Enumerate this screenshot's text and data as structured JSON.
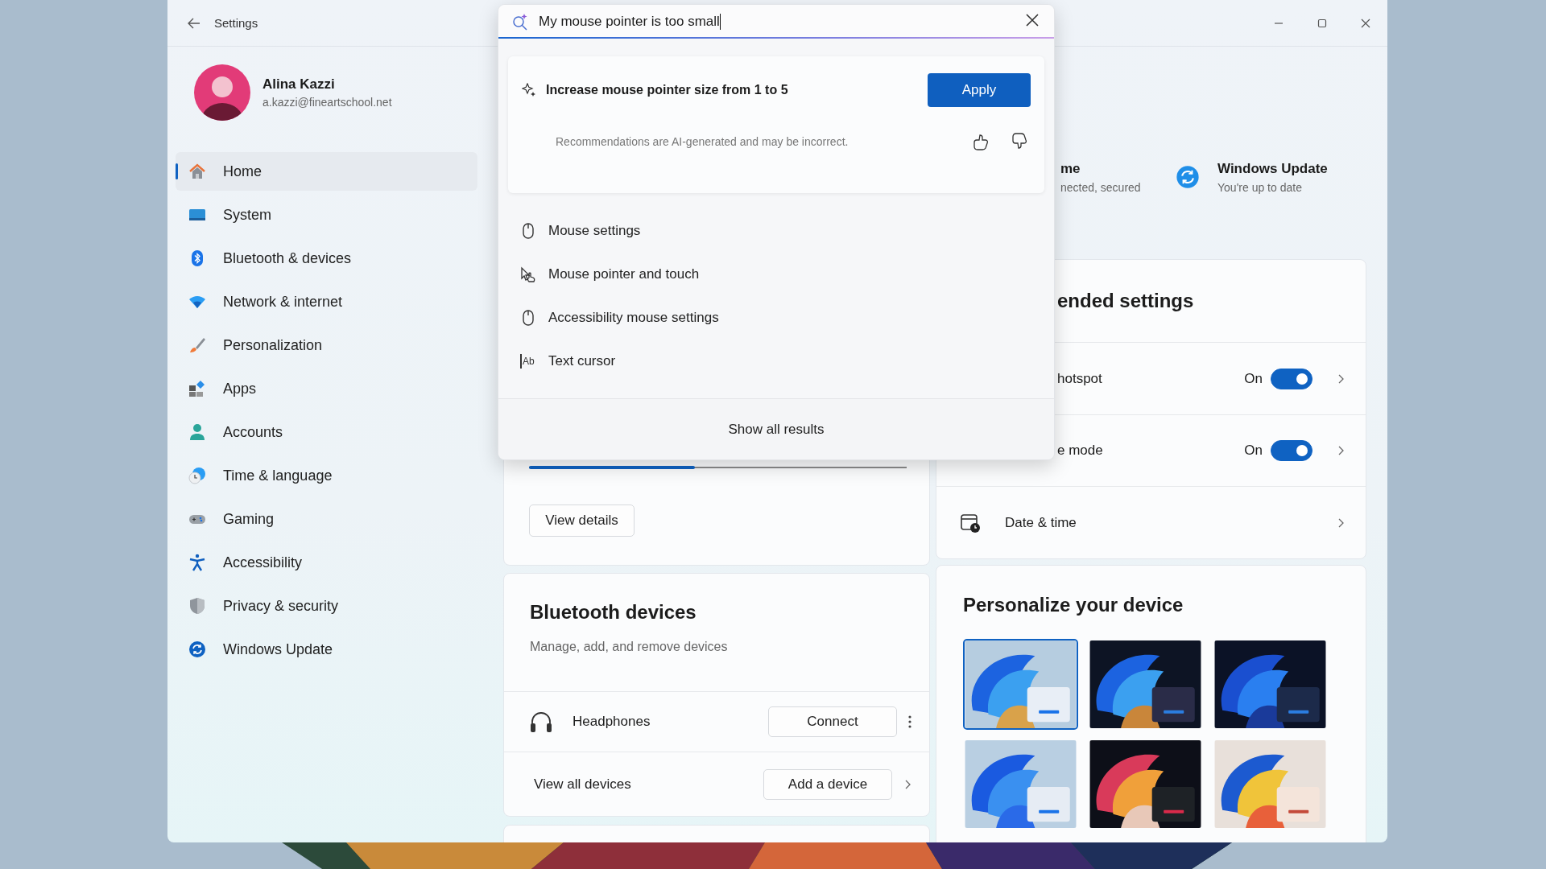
{
  "window": {
    "title": "Settings"
  },
  "profile": {
    "name": "Alina Kazzi",
    "email": "a.kazzi@fineartschool.net"
  },
  "sidebar": {
    "items": [
      {
        "label": "Home",
        "selected": true
      },
      {
        "label": "System",
        "selected": false
      },
      {
        "label": "Bluetooth & devices",
        "selected": false
      },
      {
        "label": "Network & internet",
        "selected": false
      },
      {
        "label": "Personalization",
        "selected": false
      },
      {
        "label": "Apps",
        "selected": false
      },
      {
        "label": "Accounts",
        "selected": false
      },
      {
        "label": "Time & language",
        "selected": false
      },
      {
        "label": "Gaming",
        "selected": false
      },
      {
        "label": "Accessibility",
        "selected": false
      },
      {
        "label": "Privacy & security",
        "selected": false
      },
      {
        "label": "Windows Update",
        "selected": false
      }
    ]
  },
  "status_tiles": [
    {
      "kind": "partial",
      "title": "me",
      "subtitle": "nected, secured"
    },
    {
      "kind": "update",
      "title": "Windows Update",
      "subtitle": "You're up to date"
    }
  ],
  "usage_card": {
    "level": 0.44,
    "button": "View details"
  },
  "bluetooth": {
    "title": "Bluetooth devices",
    "subtitle": "Manage, add, and remove devices",
    "device": {
      "name": "Headphones",
      "button": "Connect"
    },
    "footer": {
      "label": "View all devices",
      "button": "Add a device"
    }
  },
  "recommended": {
    "title": "ended settings",
    "rows": [
      {
        "kind": "toggle",
        "label": "hotspot",
        "state": "On",
        "on": true
      },
      {
        "kind": "toggle",
        "label": "e mode",
        "state": "On",
        "on": true
      },
      {
        "kind": "link",
        "label": "Date & time"
      }
    ]
  },
  "personalize": {
    "title": "Personalize your device",
    "themes": [
      {
        "kind": "light-bloom",
        "selected": true
      },
      {
        "kind": "dark-bloom",
        "selected": false
      },
      {
        "kind": "dark-blue",
        "selected": false
      },
      {
        "kind": "light-blue",
        "selected": false
      },
      {
        "kind": "dark-glow",
        "selected": false
      },
      {
        "kind": "flow",
        "selected": false
      }
    ]
  },
  "search": {
    "value": "My mouse pointer is too small",
    "suggestion": {
      "text": "Increase mouse pointer size from 1 to 5",
      "button": "Apply",
      "disclaimer": "Recommendations are AI-generated and may be incorrect."
    },
    "results": [
      {
        "kind": "mouse",
        "label": "Mouse settings"
      },
      {
        "kind": "pointer",
        "label": "Mouse pointer and touch"
      },
      {
        "kind": "mouse",
        "label": "Accessibility mouse settings"
      },
      {
        "kind": "text-cursor",
        "label": "Text cursor",
        "icon_text": "Ab"
      }
    ],
    "footer": "Show all results"
  }
}
